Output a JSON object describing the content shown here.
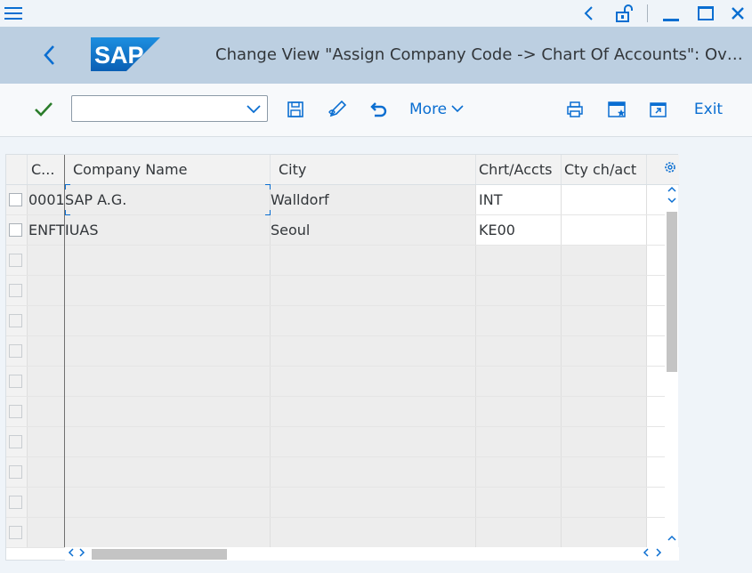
{
  "window": {
    "icons": [
      "menu-icon",
      "back-icon",
      "unlock-icon",
      "minimize-icon",
      "maximize-icon",
      "close-icon"
    ]
  },
  "header": {
    "logo_text": "SAP",
    "title": "Change View \"Assign Company Code -> Chart Of Accounts\": Ove...",
    "colors": {
      "header_bg": "#bccfe1",
      "accent": "#0a6ed1",
      "logo_blue": "#0a6ed1"
    }
  },
  "toolbar": {
    "command_field_value": "",
    "more_label": "More",
    "exit_label": "Exit"
  },
  "table": {
    "columns": [
      "C...",
      "Company Name",
      "City",
      "Chrt/Accts",
      "Cty ch/act"
    ],
    "rows": [
      {
        "code": "0001",
        "company": "SAP A.G.",
        "city": "Walldorf",
        "chart": "INT",
        "cty": ""
      },
      {
        "code": "ENFT",
        "company": "IUAS",
        "city": "Seoul",
        "chart": "KE00",
        "cty": ""
      },
      {
        "code": "",
        "company": "",
        "city": "",
        "chart": "",
        "cty": ""
      },
      {
        "code": "",
        "company": "",
        "city": "",
        "chart": "",
        "cty": ""
      },
      {
        "code": "",
        "company": "",
        "city": "",
        "chart": "",
        "cty": ""
      },
      {
        "code": "",
        "company": "",
        "city": "",
        "chart": "",
        "cty": ""
      },
      {
        "code": "",
        "company": "",
        "city": "",
        "chart": "",
        "cty": ""
      },
      {
        "code": "",
        "company": "",
        "city": "",
        "chart": "",
        "cty": ""
      },
      {
        "code": "",
        "company": "",
        "city": "",
        "chart": "",
        "cty": ""
      },
      {
        "code": "",
        "company": "",
        "city": "",
        "chart": "",
        "cty": ""
      },
      {
        "code": "",
        "company": "",
        "city": "",
        "chart": "",
        "cty": ""
      },
      {
        "code": "",
        "company": "",
        "city": "",
        "chart": "",
        "cty": ""
      }
    ]
  }
}
